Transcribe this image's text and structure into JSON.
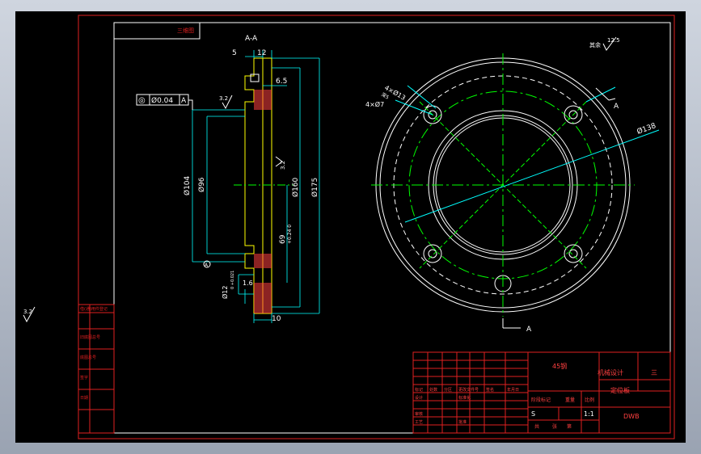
{
  "drawing": {
    "title_block_note": "三维图",
    "section_label": "A-A",
    "datum_label": "A",
    "view_arrow_label": "A",
    "general_roughness": "其余",
    "general_roughness_value": "12.5",
    "corner_roughness": "3.2",
    "flatness_roughness": "3.2",
    "inner_roughness": "3.2"
  },
  "tolerance_frame": {
    "symbol": "◎",
    "value": "Ø0.04",
    "datum": "A"
  },
  "dimensions": {
    "d5": "5",
    "d12": "12",
    "d6_5": "6.5",
    "d104": "Ø104",
    "d96": "Ø96",
    "d160": "Ø160",
    "d175": "Ø175",
    "d69": "69",
    "d69_tol": "+0.24  0",
    "d12fit": "Ø12",
    "d12fit_tol": "0  +0.021",
    "d1_6": "1.6",
    "d10": "10",
    "hole_small": "4×Ø13",
    "hole_small_sub": "深5",
    "hole_main": "4×Ø7",
    "d138": "Ø138"
  },
  "title_block": {
    "material": "45钢",
    "course": "机械设计",
    "course_right": "三",
    "part_name": "定位板",
    "scale_label": "S",
    "scale": "1:1",
    "code": "DWB",
    "stage_marks": "阶段标记",
    "weight": "重量",
    "ratio": "比例",
    "sheet_total": "共",
    "sheet_label": "张",
    "sheet_first": "第",
    "rev_marks": "标记",
    "rev_count": "处数",
    "rev_zone": "分区",
    "rev_doc": "更改文件号",
    "rev_sign": "签名",
    "rev_date": "年月日",
    "designer": "设计",
    "standard": "标准化",
    "checker": "审核",
    "craft": "工艺",
    "approve": "批准"
  },
  "side_block": {
    "row1": "借(通)用件登记",
    "row2": "旧底图总号",
    "row3": "底图总号",
    "row4": "签字",
    "row5": "日期"
  }
}
